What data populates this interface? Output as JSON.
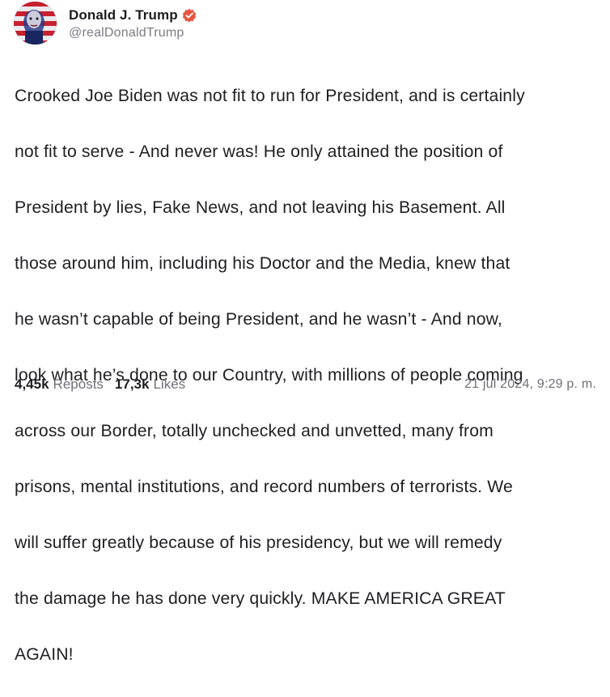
{
  "author": {
    "display_name": "Donald J. Trump",
    "handle": "@realDonaldTrump",
    "verified": true,
    "verified_color": "#e8553f"
  },
  "post": {
    "lines": [
      "Crooked Joe Biden was not fit to run for President, and is certainly",
      "not fit to serve - And never was! He only attained the position of",
      "President by lies, Fake News, and not leaving his Basement. All",
      "those around him, including his Doctor and the Media, knew that",
      "he wasn’t capable of being President, and he wasn’t - And now,",
      "look what he’s done to our Country, with millions of people coming",
      "across our Border, totally unchecked and unvetted, many from",
      "prisons, mental institutions, and record numbers of terrorists. We",
      "will suffer greatly because of his presidency, but we will remedy",
      "the damage he has done very quickly. MAKE AMERICA GREAT",
      "AGAIN!"
    ]
  },
  "stats": {
    "reposts_count": "4,45k",
    "reposts_label": "Reposts",
    "likes_count": "17,3k",
    "likes_label": "Likes"
  },
  "timestamp": "21 jul 2024, 9:29 p. m."
}
